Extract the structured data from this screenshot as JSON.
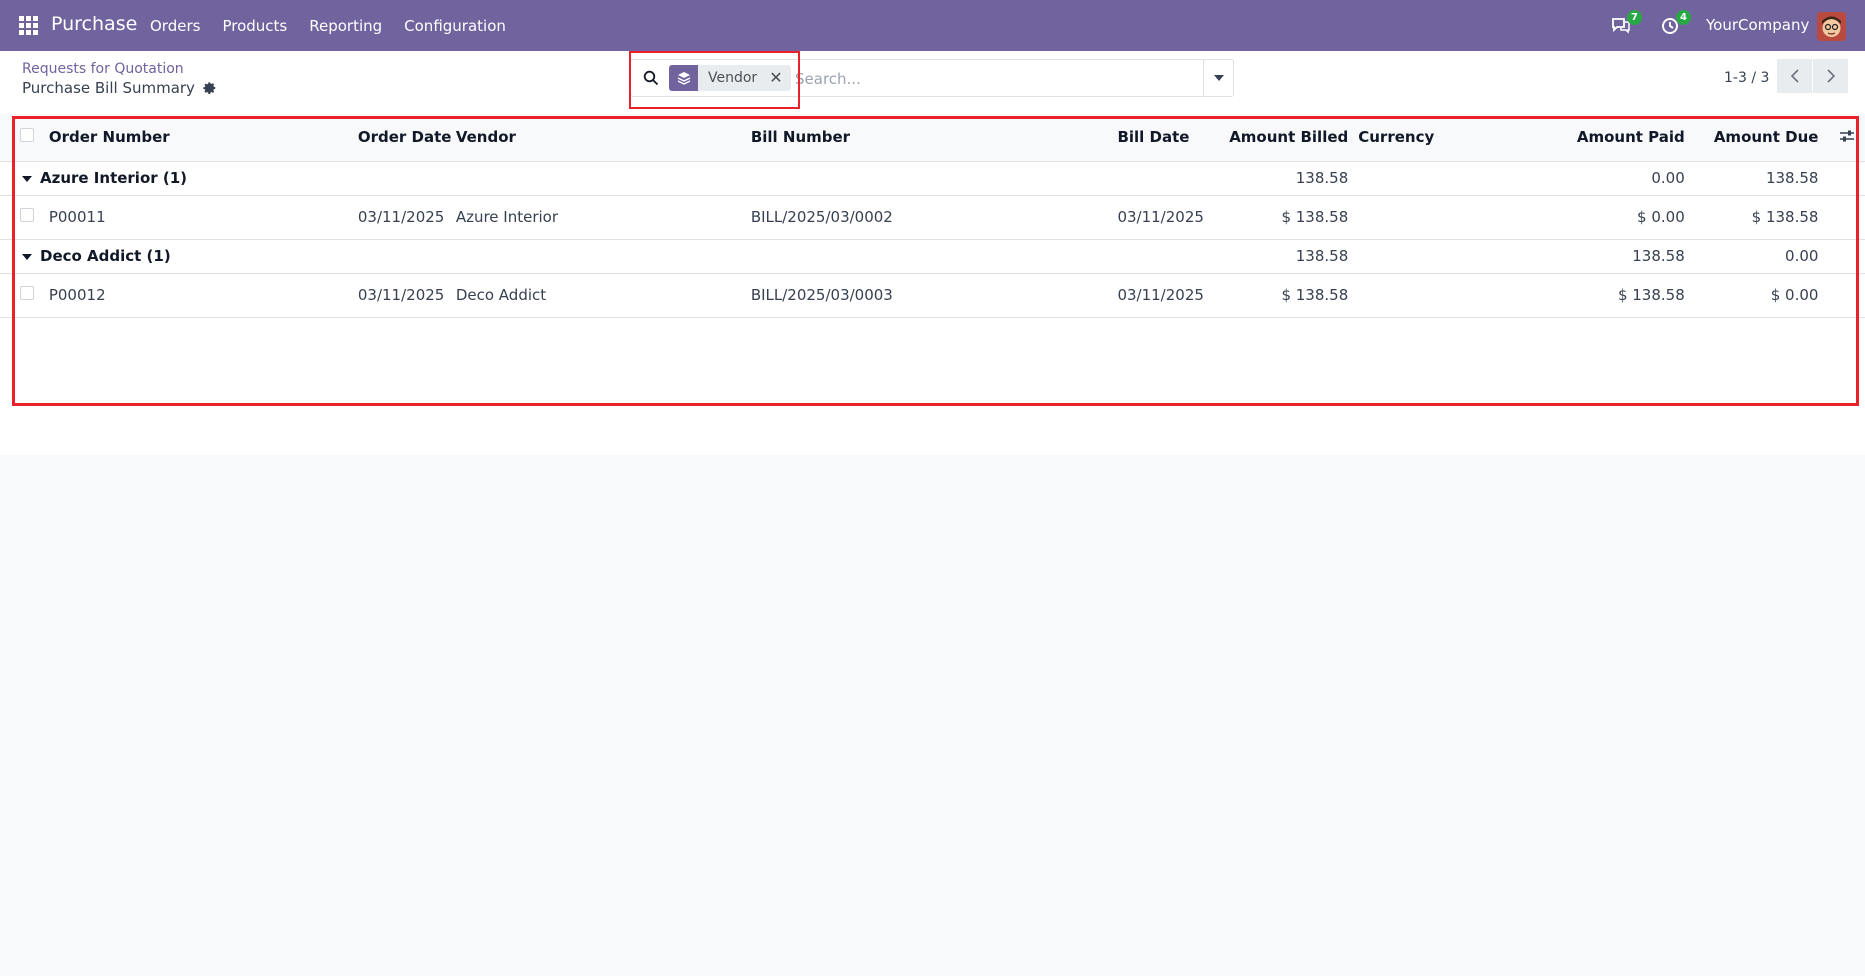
{
  "navbar": {
    "app_name": "Purchase",
    "menu": [
      "Orders",
      "Products",
      "Reporting",
      "Configuration"
    ],
    "messages_count": "7",
    "activities_count": "4",
    "company": "YourCompany",
    "bg_color": "#71639e"
  },
  "control_panel": {
    "breadcrumb": "Requests for Quotation",
    "title": "Purchase Bill Summary",
    "search": {
      "facet_label": "Vendor",
      "facet_icon": "layers-icon",
      "placeholder": "Search..."
    },
    "pager": "1-3 / 3"
  },
  "list": {
    "columns": [
      "Order Number",
      "Order Date",
      "Vendor",
      "Bill Number",
      "Bill Date",
      "Amount Billed",
      "Currency",
      "Amount Paid",
      "Amount Due"
    ],
    "groups": [
      {
        "label": "Azure Interior (1)",
        "amount_billed": "138.58",
        "amount_paid": "0.00",
        "amount_due": "138.58",
        "rows": [
          {
            "order_number": "P00011",
            "order_date": "03/11/2025",
            "vendor": "Azure Interior",
            "bill_number": "BILL/2025/03/0002",
            "bill_date": "03/11/2025",
            "amount_billed": "$ 138.58",
            "currency": "",
            "amount_paid": "$ 0.00",
            "amount_due": "$ 138.58"
          }
        ]
      },
      {
        "label": "Deco Addict (1)",
        "amount_billed": "138.58",
        "amount_paid": "138.58",
        "amount_due": "0.00",
        "rows": [
          {
            "order_number": "P00012",
            "order_date": "03/11/2025",
            "vendor": "Deco Addict",
            "bill_number": "BILL/2025/03/0003",
            "bill_date": "03/11/2025",
            "amount_billed": "$ 138.58",
            "currency": "",
            "amount_paid": "$ 138.58",
            "amount_due": "$ 0.00"
          }
        ]
      }
    ]
  }
}
